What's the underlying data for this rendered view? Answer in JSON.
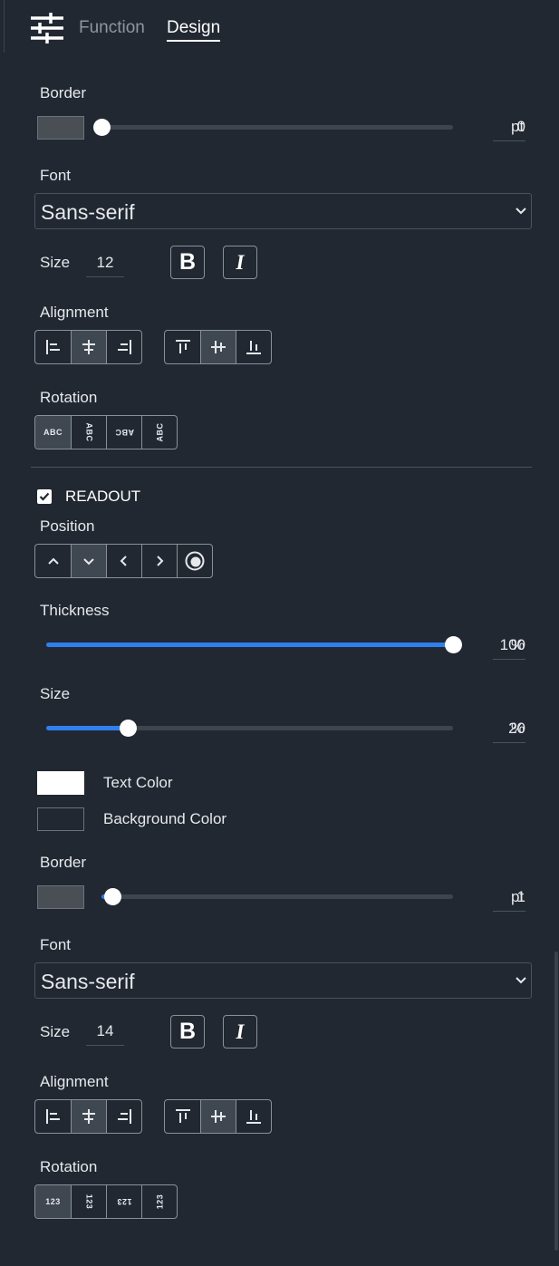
{
  "header": {
    "tabs": [
      {
        "label": "Function",
        "active": false
      },
      {
        "label": "Design",
        "active": true
      }
    ],
    "icon": "sliders-icon"
  },
  "label_section": {
    "border": {
      "label": "Border",
      "value": "0",
      "unit": "pt",
      "swatch_color": "#4a4f56",
      "fraction": 0.0
    },
    "font": {
      "label": "Font",
      "value": "Sans-serif"
    },
    "size": {
      "label": "Size",
      "value": "12"
    },
    "bold_label": "B",
    "italic_label": "I",
    "alignment": {
      "label": "Alignment",
      "horizontal_selected": "center",
      "vertical_selected": "middle"
    },
    "rotation": {
      "label": "Rotation",
      "items": [
        "ABC",
        "ABC",
        "ABC",
        "ABC"
      ],
      "selected": 0
    }
  },
  "readout_section": {
    "checkbox": {
      "label": "READOUT",
      "checked": true
    },
    "position": {
      "label": "Position",
      "selected": "down"
    },
    "thickness": {
      "label": "Thickness",
      "value": "100",
      "unit": "%",
      "fraction": 1.0
    },
    "size_slider": {
      "label": "Size",
      "value": "20",
      "unit": "%",
      "fraction": 0.2
    },
    "text_color": {
      "label": "Text Color",
      "color": "#ffffff"
    },
    "background_color": {
      "label": "Background Color",
      "color": "#212832"
    },
    "border": {
      "label": "Border",
      "value": "1",
      "unit": "pt",
      "swatch_color": "#4a4f56",
      "fraction": 0.03
    },
    "font": {
      "label": "Font",
      "value": "Sans-serif"
    },
    "size": {
      "label": "Size",
      "value": "14"
    },
    "bold_label": "B",
    "italic_label": "I",
    "alignment": {
      "label": "Alignment",
      "horizontal_selected": "center",
      "vertical_selected": "middle"
    },
    "rotation": {
      "label": "Rotation",
      "items": [
        "123",
        "123",
        "123",
        "123"
      ],
      "selected": 0
    }
  },
  "colors": {
    "accent": "#2f80ed",
    "background": "#212832"
  }
}
